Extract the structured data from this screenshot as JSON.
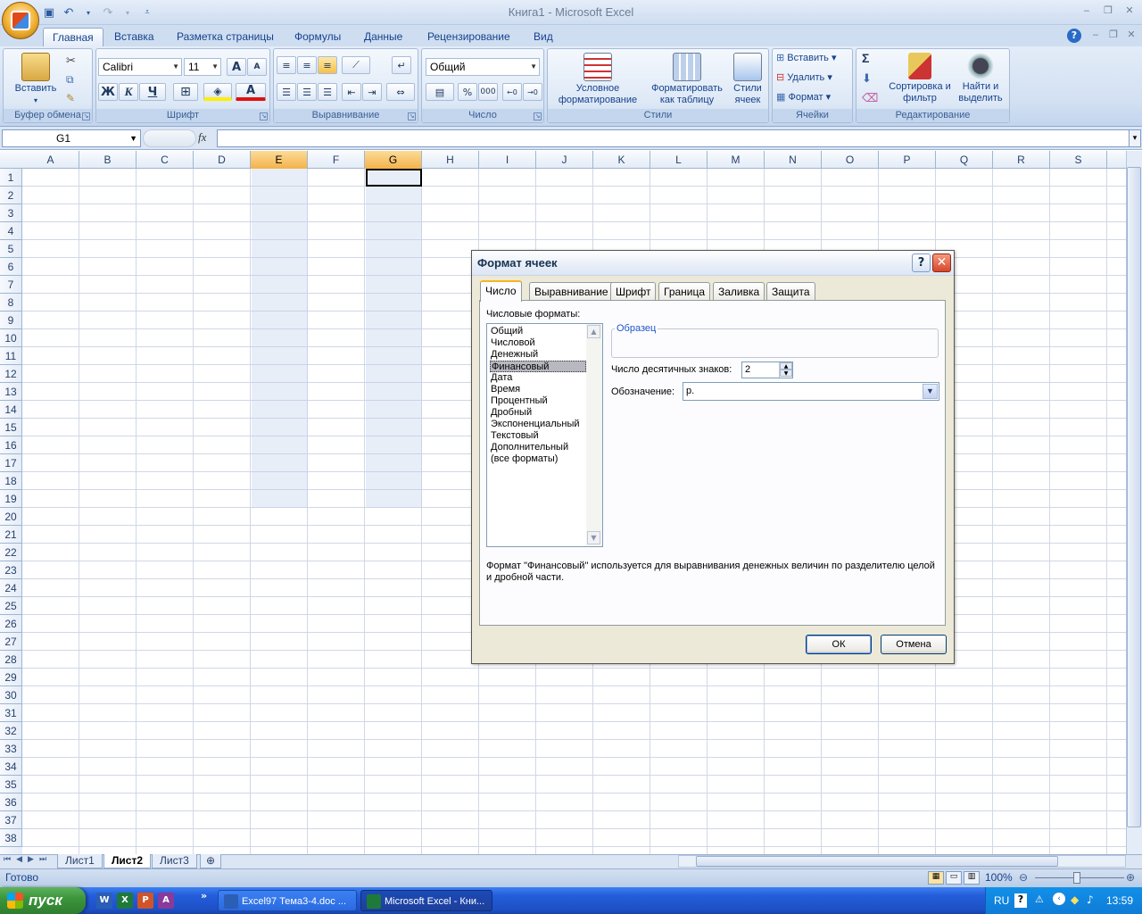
{
  "window": {
    "title": "Книга1 - Microsoft Excel",
    "minimize": "‒",
    "restore": "❐",
    "close": "✕"
  },
  "ribbon": {
    "tabs": [
      "Главная",
      "Вставка",
      "Разметка страницы",
      "Формулы",
      "Данные",
      "Рецензирование",
      "Вид"
    ],
    "clipboard": {
      "label": "Буфер обмена",
      "paste": "Вставить"
    },
    "font": {
      "label": "Шрифт",
      "name": "Calibri",
      "size": "11",
      "bold": "Ж",
      "italic": "К",
      "underline": "Ч",
      "grow": "A",
      "shrink": "A"
    },
    "alignment": {
      "label": "Выравнивание"
    },
    "number": {
      "label": "Число",
      "format": "Общий",
      "percent": "%",
      "thousands": "000"
    },
    "styles": {
      "label": "Стили",
      "conditional": "Условное форматирование",
      "table": "Форматировать как таблицу",
      "cell": "Стили ячеек"
    },
    "cells": {
      "label": "Ячейки",
      "insert": "Вставить",
      "delete": "Удалить",
      "format": "Формат"
    },
    "editing": {
      "label": "Редактирование",
      "sort": "Сортировка и фильтр",
      "find": "Найти и выделить",
      "sum": "Σ"
    }
  },
  "formula_bar": {
    "cell_ref": "G1",
    "fx": "fx",
    "value": ""
  },
  "grid": {
    "columns": [
      "A",
      "B",
      "C",
      "D",
      "E",
      "F",
      "G",
      "H",
      "I",
      "J",
      "K",
      "L",
      "M",
      "N",
      "O",
      "P",
      "Q",
      "R",
      "S"
    ],
    "selected_columns": [
      "E",
      "G"
    ],
    "rows": [
      "1",
      "2",
      "3",
      "4",
      "5",
      "6",
      "7",
      "8",
      "9",
      "10",
      "11",
      "12",
      "13",
      "14",
      "15",
      "16",
      "17",
      "18",
      "19",
      "20",
      "21",
      "22",
      "23",
      "24",
      "25",
      "26",
      "27",
      "28",
      "29",
      "30",
      "31",
      "32",
      "33",
      "34",
      "35",
      "36",
      "37",
      "38"
    ],
    "active_cell": "G1"
  },
  "sheets": {
    "tabs": [
      "Лист1",
      "Лист2",
      "Лист3"
    ],
    "active": "Лист2"
  },
  "status": {
    "text": "Готово",
    "zoom": "100%"
  },
  "dialog": {
    "title": "Формат ячеек",
    "help": "?",
    "close": "✕",
    "tabs": [
      "Число",
      "Выравнивание",
      "Шрифт",
      "Граница",
      "Заливка",
      "Защита"
    ],
    "active_tab": "Число",
    "formats_label": "Числовые форматы:",
    "formats": [
      "Общий",
      "Числовой",
      "Денежный",
      "Финансовый",
      "Дата",
      "Время",
      "Процентный",
      "Дробный",
      "Экспоненциальный",
      "Текстовый",
      "Дополнительный",
      "(все форматы)"
    ],
    "selected_format": "Финансовый",
    "sample_label": "Образец",
    "sample_value": "",
    "decimals_label": "Число десятичных знаков:",
    "decimals_value": "2",
    "symbol_label": "Обозначение:",
    "symbol_value": "р.",
    "description": "Формат \"Финансовый\" используется для выравнивания денежных величин по разделителю целой и дробной части.",
    "ok": "ОК",
    "cancel": "Отмена"
  },
  "taskbar": {
    "start": "пуск",
    "items": [
      "Excel97 Тема3-4.doc ...",
      "Microsoft Excel - Кни..."
    ],
    "lang": "RU",
    "clock": "13:59"
  }
}
